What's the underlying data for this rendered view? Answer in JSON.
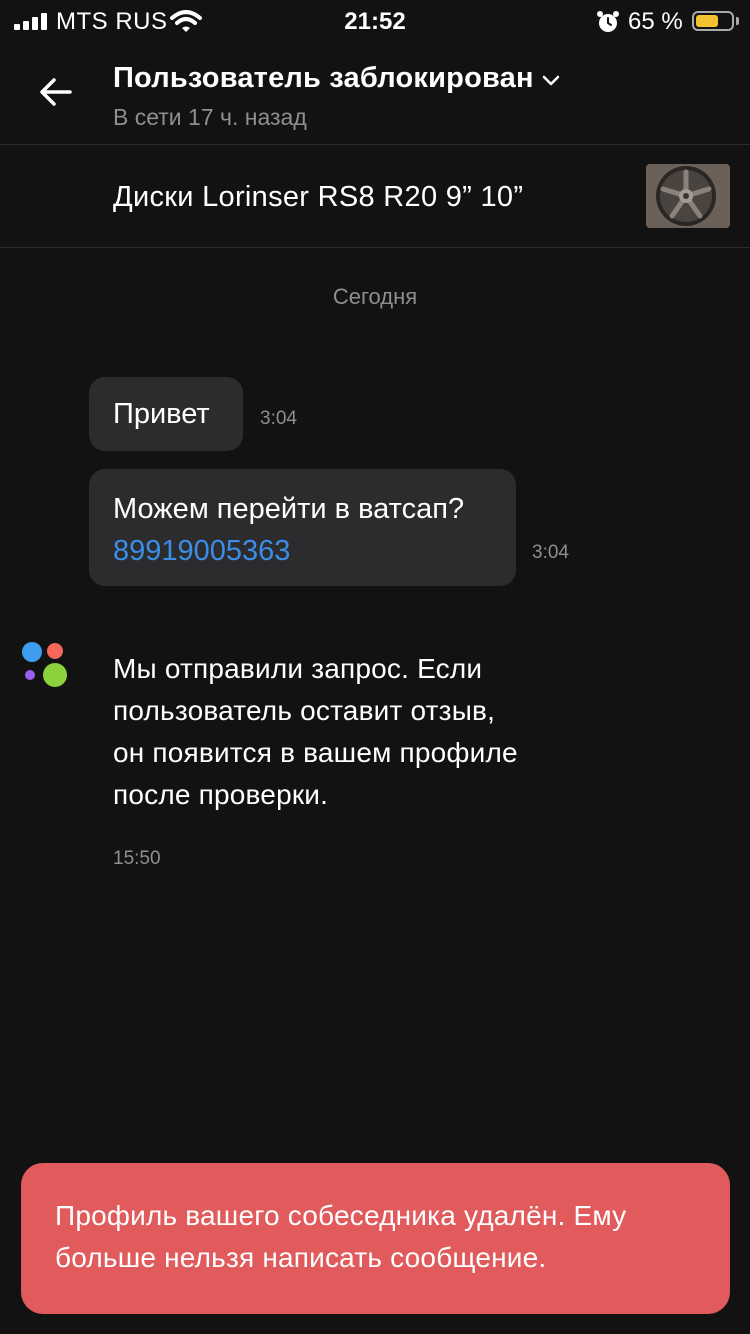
{
  "status_bar": {
    "carrier": "MTS RUS",
    "time": "21:52",
    "battery_percent": "65 %",
    "battery_level": 0.65,
    "battery_color": "#f2c230"
  },
  "header": {
    "title": "Пользователь заблокирован",
    "subtitle": "В сети 17 ч. назад",
    "back_icon": "arrow-left-icon",
    "dropdown_icon": "chevron-down-icon"
  },
  "ad": {
    "title": "Диски Lorinser RS8 R20 9” 10”"
  },
  "chat": {
    "date_separator": "Сегодня",
    "messages": [
      {
        "text": "Привет",
        "time": "3:04"
      },
      {
        "text": "Можем перейти в ватсап?",
        "link": "89919005363",
        "time": "3:04"
      }
    ],
    "system_message": {
      "lines": [
        "Мы отправили запрос. Если",
        "пользователь оставит отзыв,",
        "он появится в вашем профиле",
        "после проверки."
      ],
      "time": "15:50"
    }
  },
  "toast": {
    "lines": [
      "Профиль вашего собеседника удалён. Ему",
      "больше нельзя написать сообщение."
    ],
    "color": "#e15a5c"
  },
  "colors": {
    "background": "#121212",
    "bubble": "#2c2c2e",
    "link": "#3a8ee6",
    "muted_text": "#8e8e93"
  }
}
